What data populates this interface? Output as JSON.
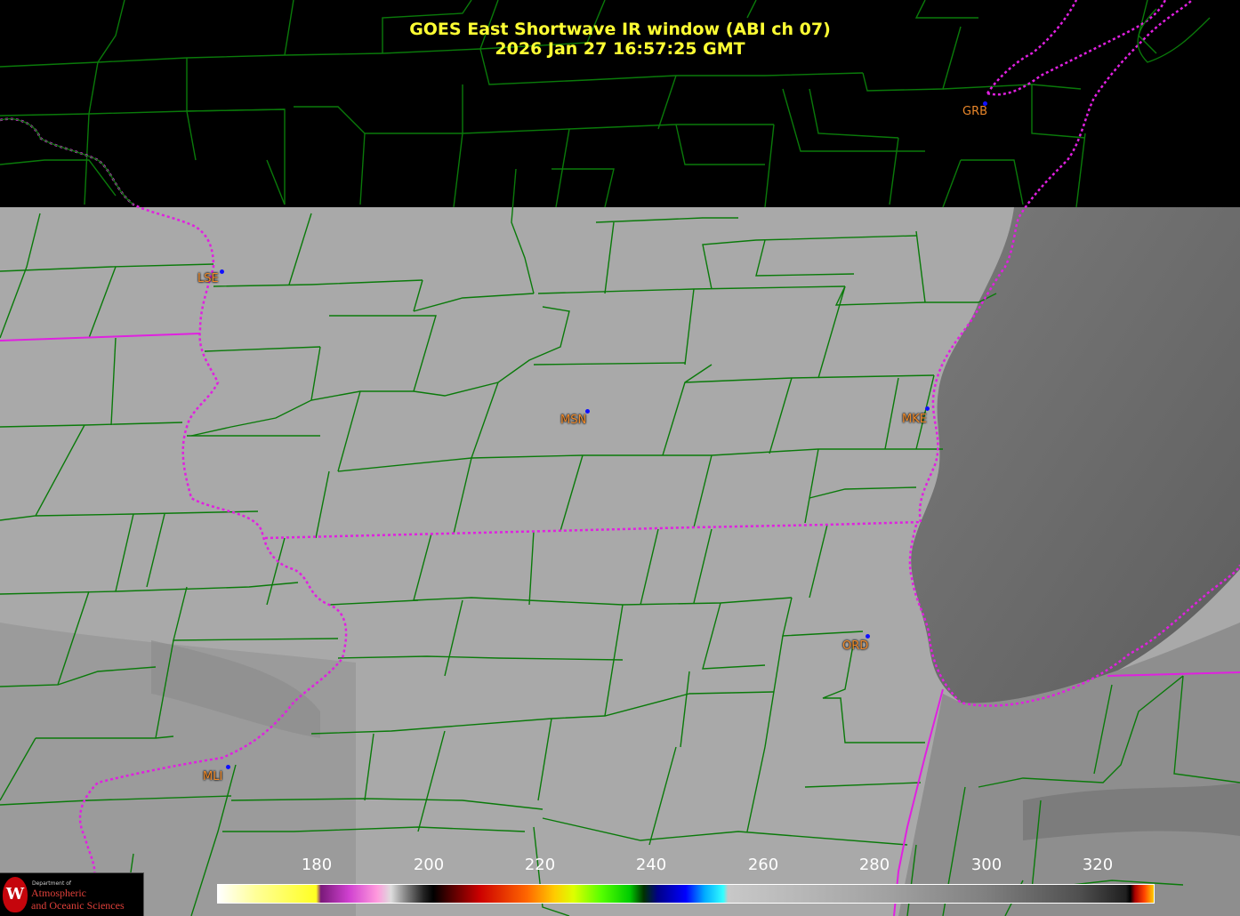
{
  "title_line1": "GOES East Shortwave IR window (ABI ch 07)",
  "title_line2": "2026 Jan 27  16:57:25 GMT",
  "stations": [
    {
      "id": "GRB",
      "label": "GRB"
    },
    {
      "id": "LSE",
      "label": "LSE"
    },
    {
      "id": "MSN",
      "label": "MSN"
    },
    {
      "id": "MKE",
      "label": "MKE"
    },
    {
      "id": "ORD",
      "label": "ORD"
    },
    {
      "id": "MLI",
      "label": "MLI"
    }
  ],
  "colorbar": {
    "ticks": [
      "180",
      "200",
      "220",
      "240",
      "260",
      "280",
      "300",
      "320"
    ]
  },
  "logo": {
    "seal_letter": "W",
    "line1": "Department of",
    "line2": "Atmospheric",
    "line3": "and Oceanic Sciences"
  },
  "colors": {
    "title": "#ffff33",
    "state_border": "#e020e0",
    "county_lines": "#0a7a0a",
    "station_label": "#f08a2a",
    "station_dot": "#1010ff",
    "land_gray": "#a8a8a8",
    "lake_gray": "#6e6e6e"
  }
}
